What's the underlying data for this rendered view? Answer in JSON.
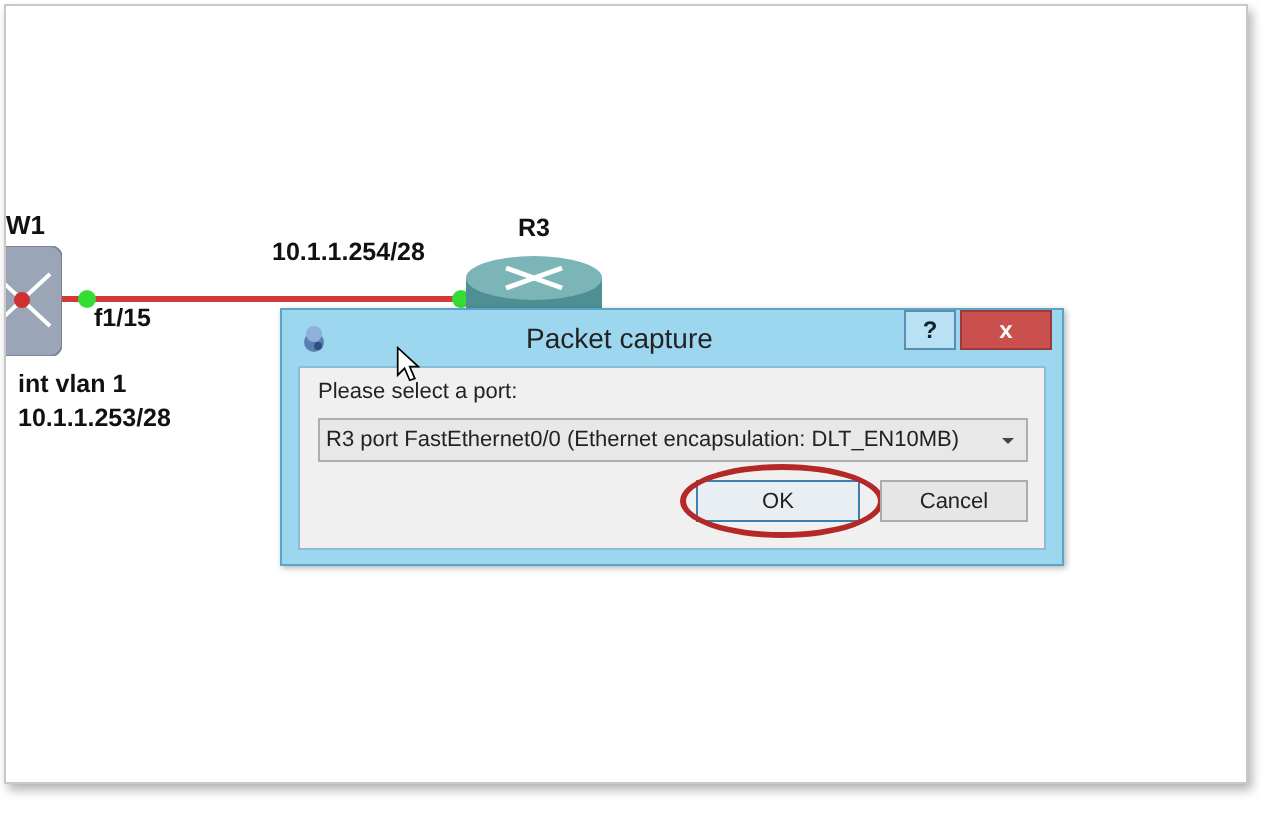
{
  "topology": {
    "nodes": [
      {
        "kind": "switch",
        "label": "W1"
      },
      {
        "kind": "router",
        "label": "R3"
      }
    ],
    "link": {
      "ports": [
        {
          "label": "f1/15"
        },
        {
          "label": "10.1.1.254/28"
        }
      ]
    },
    "notes": [
      "int vlan 1",
      "10.1.1.253/28"
    ]
  },
  "dialog": {
    "title": "Packet capture",
    "title_buttons": [
      {
        "kind": "help",
        "label": "?"
      },
      {
        "kind": "close",
        "label": "x"
      }
    ],
    "prompt": "Please select a port:",
    "port_select": {
      "value": "R3 port FastEthernet0/0 (Ethernet encapsulation: DLT_EN10MB)"
    },
    "buttons": [
      {
        "label": "OK",
        "highlighted": true
      },
      {
        "label": "Cancel",
        "highlighted": false
      }
    ]
  }
}
